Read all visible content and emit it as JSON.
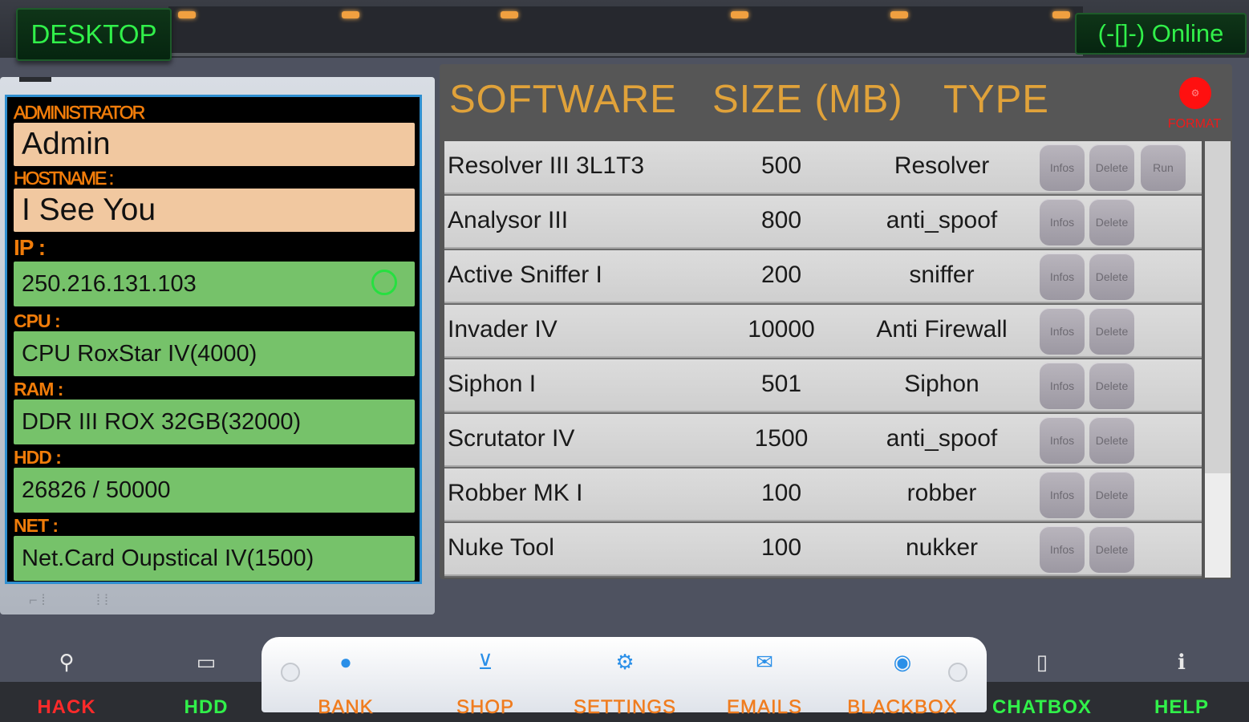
{
  "topbar": {
    "desktop_label": "DESKTOP",
    "online_label": "(-[]-) Online"
  },
  "info": {
    "admin_label": "ADMINISTRATOR",
    "admin_value": "Admin",
    "host_label": "HOSTNAME :",
    "host_value": "I See You",
    "ip_label": "IP :",
    "ip_value": "250.216.131.103",
    "cpu_label": "CPU :",
    "cpu_value": "CPU RoxStar IV(4000)",
    "ram_label": "RAM :",
    "ram_value": "DDR III ROX 32GB(32000)",
    "hdd_label": "HDD :",
    "hdd_value": "26826 / 50000",
    "net_label": "NET :",
    "net_value": "Net.Card Oupstical IV(1500)"
  },
  "table": {
    "headers": {
      "software": "SOFTWARE",
      "size": "SIZE (MB)",
      "type": "TYPE"
    },
    "format_label": "FORMAT",
    "info_label": "Infos",
    "delete_label": "Delete",
    "run_label": "Run",
    "rows": [
      {
        "name": "Resolver III 3L1T3",
        "size": "500",
        "type": "Resolver"
      },
      {
        "name": "Analysor III",
        "size": "800",
        "type": "anti_spoof"
      },
      {
        "name": "Active Sniffer I",
        "size": "200",
        "type": "sniffer"
      },
      {
        "name": "Invader IV",
        "size": "10000",
        "type": "Anti Firewall"
      },
      {
        "name": "Siphon I",
        "size": "501",
        "type": "Siphon"
      },
      {
        "name": "Scrutator IV",
        "size": "1500",
        "type": "anti_spoof"
      },
      {
        "name": "Robber MK I",
        "size": "100",
        "type": "robber"
      },
      {
        "name": "Nuke Tool",
        "size": "100",
        "type": "nukker"
      }
    ]
  },
  "dock": {
    "hack": "HACK",
    "hdd": "HDD",
    "bank": "BANK",
    "shop": "SHOP",
    "settings": "SETTINGS",
    "emails": "EMAILS",
    "blackbox": "BLACKBOX",
    "chatbox": "CHATBOX",
    "help": "HELP"
  },
  "colors": {
    "accent_orange": "#e0a23a",
    "label_orange": "#f07c0a",
    "online_green": "#31f04a",
    "hack_red": "#ff2a2a",
    "field_green": "#76c26a",
    "field_beige": "#f1c8a0"
  },
  "icons": {
    "hack": "wrench-icon",
    "hdd": "drive-icon",
    "bank": "chat-bubble-icon",
    "shop": "cart-icon",
    "settings": "gears-icon",
    "emails": "envelope-icon",
    "blackbox": "disc-icon",
    "chatbox": "phone-icon",
    "help": "info-icon"
  }
}
